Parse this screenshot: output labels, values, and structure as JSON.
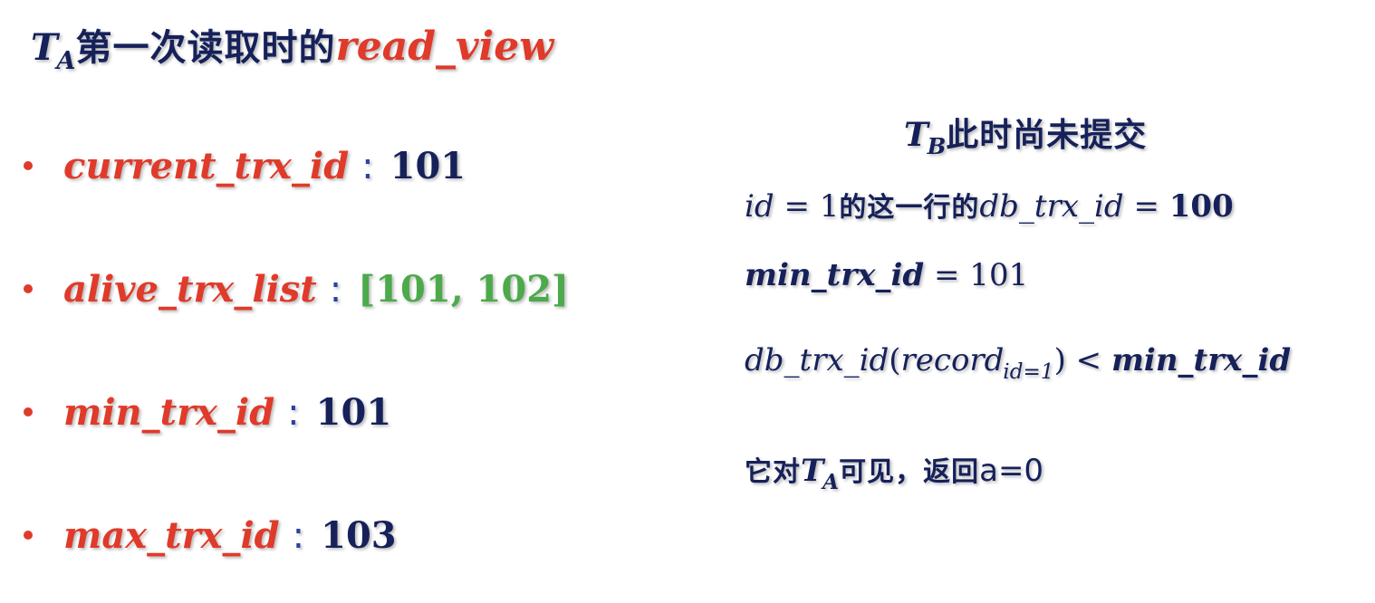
{
  "title": {
    "t_letter": "T",
    "t_sub": "A",
    "text_cn": "第一次读取时的",
    "text_red": "read_view"
  },
  "bullets": [
    {
      "key": "current_trx_id",
      "colon": ":",
      "value": "101",
      "value_color": "#16215a"
    },
    {
      "key": "alive_trx_list",
      "colon": ":",
      "value": "[101, 102]",
      "value_color": "#4caa4a"
    },
    {
      "key": "min_trx_id",
      "colon": ":",
      "value": "101",
      "value_color": "#16215a"
    },
    {
      "key": "max_trx_id",
      "colon": ":",
      "value": "103",
      "value_color": "#16215a"
    }
  ],
  "right": {
    "heading": {
      "t_letter": "T",
      "t_sub": "B",
      "text_cn": "此时尚未提交"
    },
    "line1": {
      "lhs": "id",
      "eq": " = 1",
      "cn": "的这一行的",
      "var": "db_trx_id",
      "eq2": " = ",
      "value": "100"
    },
    "line2": {
      "var": "min_trx_id",
      "eq": " = 101"
    },
    "line3": {
      "lhs": "db_trx_id",
      "open": "(",
      "rec": "record",
      "rec_sub": "id=1",
      "close": ")",
      "op": " < ",
      "rhs": "min_trx_id"
    },
    "line4": {
      "cn1": "它对",
      "t_letter": "T",
      "t_sub": "A",
      "cn2": "可见，返回",
      "value": "a=0"
    }
  },
  "colors": {
    "red": "#e03a2a",
    "navy": "#16215a",
    "green": "#4caa4a",
    "colon_blue": "#2c41a0"
  }
}
